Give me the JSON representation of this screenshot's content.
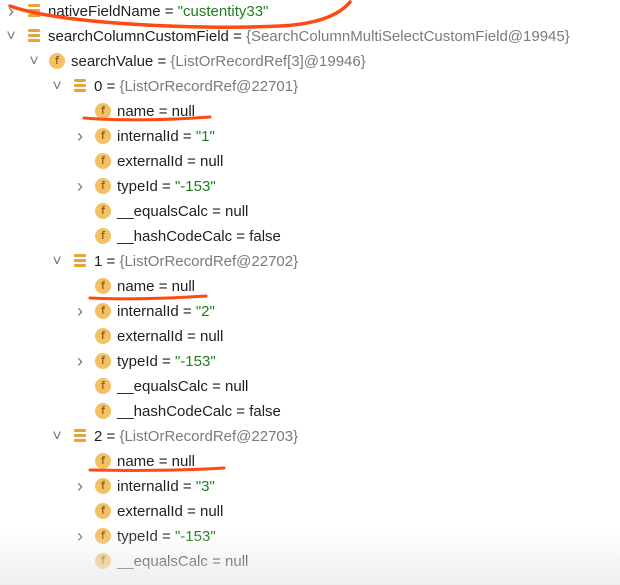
{
  "tree": {
    "rows": [
      {
        "icon": "array-icon",
        "arrow": "collapsed",
        "key": "nativeFieldName",
        "value": "\"custentity33\"",
        "value_type": "string"
      },
      {
        "icon": "array-icon",
        "arrow": "expanded",
        "key": "searchColumnCustomField",
        "value": "{SearchColumnMultiSelectCustomField@19945}",
        "value_type": "ref"
      },
      {
        "icon": "field-icon",
        "arrow": "expanded",
        "key": "searchValue",
        "value": "{ListOrRecordRef[3]@19946}",
        "value_type": "ref"
      },
      {
        "icon": "array-icon",
        "arrow": "expanded",
        "key": "0",
        "value": "{ListOrRecordRef@22701}",
        "value_type": "ref"
      },
      {
        "icon": "field-icon",
        "arrow": "none",
        "key": "name",
        "value": "null",
        "value_type": "keyword"
      },
      {
        "icon": "field-icon",
        "arrow": "collapsed",
        "key": "internalId",
        "value": "\"1\"",
        "value_type": "string"
      },
      {
        "icon": "field-icon",
        "arrow": "none",
        "key": "externalId",
        "value": "null",
        "value_type": "keyword"
      },
      {
        "icon": "field-icon",
        "arrow": "collapsed",
        "key": "typeId",
        "value": "\"-153\"",
        "value_type": "string"
      },
      {
        "icon": "field-icon",
        "arrow": "none",
        "key": "__equalsCalc",
        "value": "null",
        "value_type": "keyword"
      },
      {
        "icon": "field-icon",
        "arrow": "none",
        "key": "__hashCodeCalc",
        "value": "false",
        "value_type": "keyword"
      },
      {
        "icon": "array-icon",
        "arrow": "expanded",
        "key": "1",
        "value": "{ListOrRecordRef@22702}",
        "value_type": "ref"
      },
      {
        "icon": "field-icon",
        "arrow": "none",
        "key": "name",
        "value": "null",
        "value_type": "keyword"
      },
      {
        "icon": "field-icon",
        "arrow": "collapsed",
        "key": "internalId",
        "value": "\"2\"",
        "value_type": "string"
      },
      {
        "icon": "field-icon",
        "arrow": "none",
        "key": "externalId",
        "value": "null",
        "value_type": "keyword"
      },
      {
        "icon": "field-icon",
        "arrow": "collapsed",
        "key": "typeId",
        "value": "\"-153\"",
        "value_type": "string"
      },
      {
        "icon": "field-icon",
        "arrow": "none",
        "key": "__equalsCalc",
        "value": "null",
        "value_type": "keyword"
      },
      {
        "icon": "field-icon",
        "arrow": "none",
        "key": "__hashCodeCalc",
        "value": "false",
        "value_type": "keyword"
      },
      {
        "icon": "array-icon",
        "arrow": "expanded",
        "key": "2",
        "value": "{ListOrRecordRef@22703}",
        "value_type": "ref"
      },
      {
        "icon": "field-icon",
        "arrow": "none",
        "key": "name",
        "value": "null",
        "value_type": "keyword"
      },
      {
        "icon": "field-icon",
        "arrow": "collapsed",
        "key": "internalId",
        "value": "\"3\"",
        "value_type": "string"
      },
      {
        "icon": "field-icon",
        "arrow": "none",
        "key": "externalId",
        "value": "null",
        "value_type": "keyword"
      },
      {
        "icon": "field-icon",
        "arrow": "collapsed",
        "key": "typeId",
        "value": "\"-153\"",
        "value_type": "string"
      },
      {
        "icon": "field-icon",
        "arrow": "none",
        "key": "__equalsCalc",
        "value": "null",
        "value_type": "keyword"
      }
    ],
    "field_icon_glyph": "f",
    "equals": "="
  },
  "colors": {
    "string_value": "#1a7f1a",
    "ref_value": "#7a7a7a",
    "annotation_stroke": "#ff4a12",
    "field_icon_bg": "#f4c062",
    "array_icon_bg": "#e8a33a"
  }
}
